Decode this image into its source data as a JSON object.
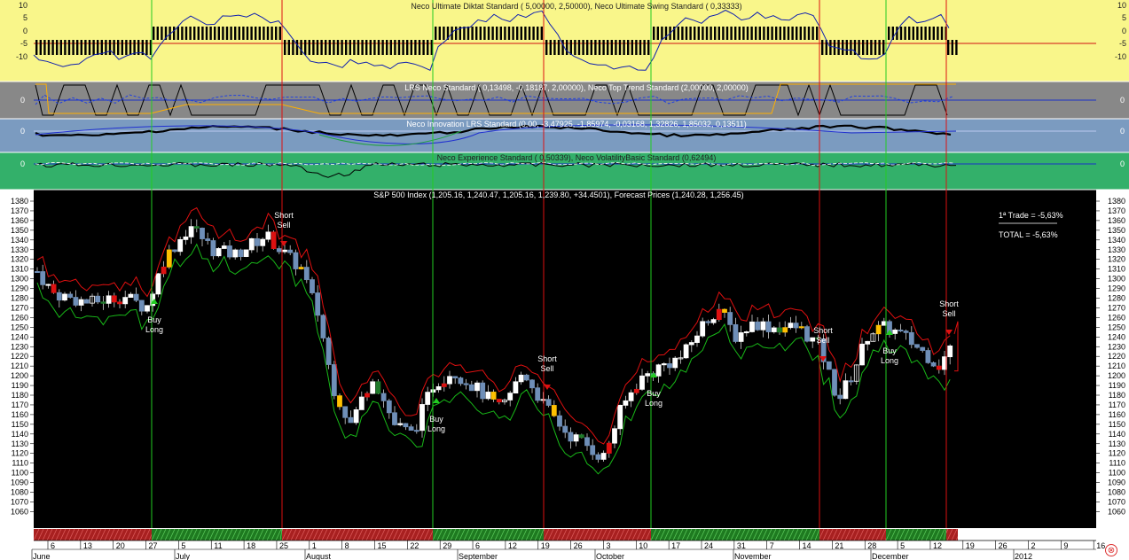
{
  "panels": {
    "diktat": {
      "title": "Neco Ultimate Diktat Standard ( 5,00000, 2,50000), Neco Ultimate Swing Standard ( 0,33333)",
      "ticks": [
        "10",
        "5",
        "0",
        "-5",
        "-10"
      ],
      "bg": "#f9f68a"
    },
    "trend": {
      "title": "LRS Neco Standard ( 0,13498, -0,18187, 2,00000), Neco Top Trend Standard (2,00000, 2,00000)",
      "ticks": [
        "0"
      ],
      "bg": "#888888"
    },
    "innovation": {
      "title": "Neco Innovation LRS Standard (0,00, -3,47925, -1,85974, -0,03168, 1,32826, 1,85032, 0,13511)",
      "ticks": [
        "0"
      ],
      "bg": "#7b9bc0"
    },
    "experience": {
      "title": "Neco Experience Standard ( 0,50339), Neco VolatilityBasic Standard (0,62494)",
      "ticks": [
        "0"
      ],
      "bg": "#33b06a"
    },
    "price": {
      "title": "S&P 500 Index (1,205.16, 1,240.47, 1,205.16, 1,239.80, +34.4501), Forecast Prices (1,240.28, 1,256.45)",
      "ticks": [
        "1380",
        "1370",
        "1360",
        "1350",
        "1340",
        "1330",
        "1320",
        "1310",
        "1300",
        "1290",
        "1280",
        "1270",
        "1260",
        "1250",
        "1240",
        "1230",
        "1220",
        "1210",
        "1200",
        "1190",
        "1180",
        "1170",
        "1160",
        "1150",
        "1140",
        "1130",
        "1120",
        "1110",
        "1100",
        "1090",
        "1080",
        "1070",
        "1060"
      ],
      "bg": "#000000"
    }
  },
  "stats": {
    "trade": "1ª Trade = -5,63%",
    "total": "TOTAL = -5,63%"
  },
  "signals": [
    {
      "lines": [
        "Buy",
        "Long"
      ],
      "type": "buy"
    },
    {
      "lines": [
        "Short",
        "Sell"
      ],
      "type": "sell"
    },
    {
      "lines": [
        "Buy",
        "Long"
      ],
      "type": "buy"
    },
    {
      "lines": [
        "Short",
        "Sell"
      ],
      "type": "sell"
    },
    {
      "lines": [
        "Buy",
        "Long"
      ],
      "type": "buy"
    },
    {
      "lines": [
        "Short",
        "Sell"
      ],
      "type": "sell"
    },
    {
      "lines": [
        "Buy",
        "Long"
      ],
      "type": "buy"
    },
    {
      "lines": [
        "Short",
        "Sell"
      ],
      "type": "sell"
    }
  ],
  "axis": {
    "days": [
      "6",
      "13",
      "20",
      "27",
      "5",
      "11",
      "18",
      "25",
      "1",
      "8",
      "15",
      "22",
      "29",
      "6",
      "12",
      "19",
      "26",
      "3",
      "10",
      "17",
      "24",
      "31",
      "7",
      "14",
      "21",
      "28",
      "5",
      "12",
      "19",
      "26",
      "2",
      "9",
      "16"
    ],
    "months": [
      "June",
      "July",
      "August",
      "September",
      "October",
      "November",
      "December",
      "2012"
    ]
  },
  "colors": {
    "buy": "#22cc22",
    "sell": "#dd1111",
    "bull": "#ffffff",
    "bear": "#6f8fb8",
    "accent": "#ffc000"
  },
  "icons": {
    "close": "close-icon"
  },
  "close_glyph": "⊗"
}
